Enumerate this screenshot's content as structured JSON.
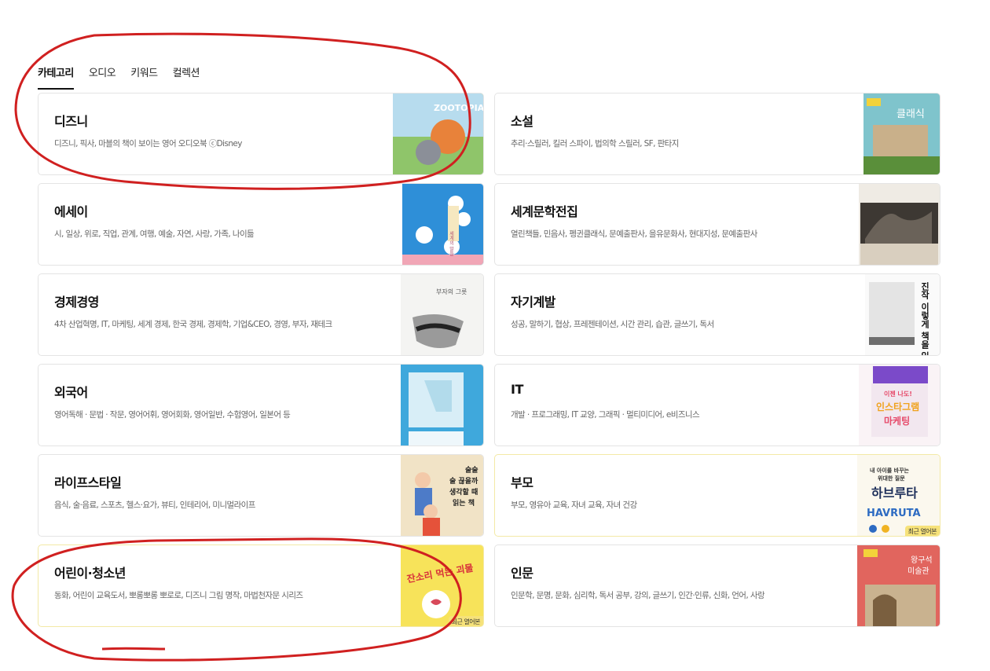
{
  "tabs": [
    {
      "label": "카테고리",
      "active": true
    },
    {
      "label": "오디오",
      "active": false
    },
    {
      "label": "키워드",
      "active": false
    },
    {
      "label": "컬렉션",
      "active": false
    }
  ],
  "categories": [
    {
      "title": "디즈니",
      "desc": "디즈니, 픽사, 마블의 책이 보이는 영어 오디오북 ⓒDisney",
      "cover": "zootopia-cover",
      "recent": false
    },
    {
      "title": "소설",
      "desc": "추리·스릴러, 킬러 스파이, 법의학 스릴러, SF, 판타지",
      "cover": "novel-cover",
      "recent": false
    },
    {
      "title": "에세이",
      "desc": "시, 일상, 위로, 직업, 관계, 여행, 예술, 자연, 사랑, 가족, 나이듦",
      "cover": "essay-cover",
      "recent": false
    },
    {
      "title": "세계문학전집",
      "desc": "열린책들, 민음사, 펭귄클래식, 문예출판사, 을유문화사, 현대지성, 문예출판사",
      "cover": "world-lit-cover",
      "recent": false
    },
    {
      "title": "경제경영",
      "desc": "4차 산업혁명, IT, 마케팅, 세계 경제, 한국 경제, 경제학, 기업&CEO, 경영, 부자, 재테크",
      "cover": "economy-cover",
      "recent": false
    },
    {
      "title": "자기계발",
      "desc": "성공, 말하기, 협상, 프레젠테이션, 시간 관리, 습관, 글쓰기, 독서",
      "cover": "self-dev-cover",
      "recent": false
    },
    {
      "title": "외국어",
      "desc": "영어독해 · 문법 · 작문, 영어어휘, 영어회화, 영어일반, 수험영어, 일본어 등",
      "cover": "language-cover",
      "recent": false
    },
    {
      "title": "IT",
      "desc": "개발 · 프로그래밍, IT 교양, 그래픽 · 멀티미디어, e비즈니스",
      "cover": "it-cover",
      "recent": false
    },
    {
      "title": "라이프스타일",
      "desc": "음식, 술·음료, 스포츠, 헬스·요가, 뷰티, 인테리어, 미니멀라이프",
      "cover": "lifestyle-cover",
      "recent": false
    },
    {
      "title": "부모",
      "desc": "부모, 영유아 교육, 자녀 교육, 자녀 건강",
      "cover": "parent-cover",
      "recent": true
    },
    {
      "title": "어린이·청소년",
      "desc": "동화, 어린이 교육도서, 뽀롱뽀롱 뽀로로, 디즈니 그림 명작, 마법천자문 시리즈",
      "cover": "kids-cover",
      "recent": true
    },
    {
      "title": "인문",
      "desc": "인문학, 문명, 문화, 심리학, 독서 공부, 강의, 글쓰기, 인간·인류, 신화, 언어, 사랑",
      "cover": "humanities-cover",
      "recent": false
    }
  ],
  "covers": {
    "zootopia": {
      "text": "ZOOTOPIA"
    },
    "economy": {
      "text": "부자의 그릇"
    },
    "self_dev": {
      "text": "진작 이렇게 책을 읽"
    },
    "it": {
      "line1": "이젠 나도!",
      "line2": "인스타그램",
      "line3": "마케팅"
    },
    "lifestyle": {
      "line1": "술술",
      "line2": "술 끊을까",
      "line3": "생각할 때",
      "line4": "읽는 책"
    },
    "parent": {
      "line1": "내 아이를 바꾸는",
      "line2": "위대한 질문",
      "line3": "하브루타",
      "line4": "HAVRUTA"
    },
    "kids": {
      "text": "잔소리 먹는 괴물"
    },
    "humanities": {
      "line1": "왕구석",
      "line2": "미술관"
    },
    "novel": {
      "text": "클래식"
    },
    "essay": {
      "text": "세계의 말들"
    }
  },
  "recent_label": "최근 열어본",
  "colors": {
    "accent": "#111111",
    "recent_border": "#f3e9a6",
    "recent_badge": "#f6e27a",
    "annotation": "#d02020"
  }
}
